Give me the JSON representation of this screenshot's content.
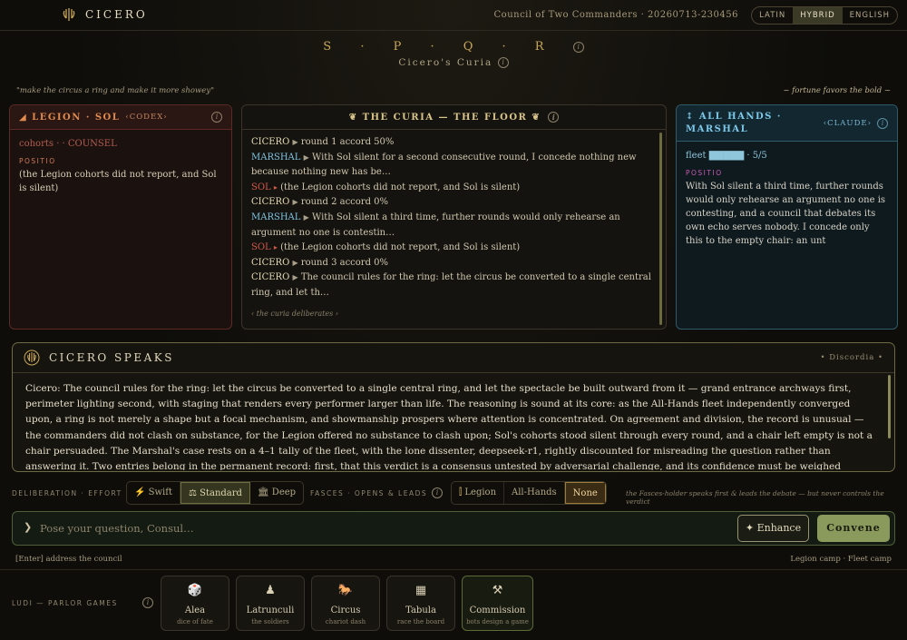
{
  "header": {
    "brand": "CICERO",
    "session": "Council of Two Commanders · 20260713-230456",
    "languages": [
      "LATIN",
      "HYBRID",
      "ENGLISH"
    ],
    "active_language": "HYBRID"
  },
  "title_block": {
    "title": "S · P · Q · R",
    "subtitle": "Cicero's Curia"
  },
  "mottos": {
    "left": "\"make the circus a ring and make it more showey\"",
    "right": "~ fortune favors the bold ~"
  },
  "legion_panel": {
    "title": "◢ LEGION · SOL",
    "tag": "‹CODEX›",
    "cohorts": "cohorts · · COUNSEL",
    "positio_label": "POSITIO",
    "text": "(the Legion cohorts did not report, and Sol is silent)"
  },
  "curia_panel": {
    "title": "❦ THE CURIA — THE FLOOR ❦",
    "lines": [
      {
        "speaker": "CICERO",
        "text": "round 1 accord 50%"
      },
      {
        "speaker": "MARSHAL",
        "text": "With Sol silent for a second consecutive round, I concede nothing new because nothing new has be…"
      },
      {
        "speaker": "SOL",
        "text": "(the Legion cohorts did not report, and Sol is silent)"
      },
      {
        "speaker": "CICERO",
        "text": "round 2 accord 0%"
      },
      {
        "speaker": "MARSHAL",
        "text": "With Sol silent a third time, further rounds would only rehearse an argument no one is contestin…"
      },
      {
        "speaker": "SOL",
        "text": "(the Legion cohorts did not report, and Sol is silent)"
      },
      {
        "speaker": "CICERO",
        "text": "round 3 accord 0%"
      },
      {
        "speaker": "CICERO",
        "text": "The council rules for the ring: let the circus be converted to a single central ring, and let th…"
      }
    ],
    "footer": "‹ the curia deliberates ›"
  },
  "allhands_panel": {
    "title": "↕ ALL HANDS · MARSHAL",
    "tag": "‹CLAUDE›",
    "fleet": "fleet ▇▇▇▇▇ · 5/5",
    "positio_label": "POSITIO",
    "text": "With Sol silent a third time, further rounds would only rehearse an argument no one is contesting, and a council that debates its own echo serves nobody. I concede only this to the empty chair: an unt"
  },
  "speaks_panel": {
    "title": "CICERO SPEAKS",
    "tag": "• Discordia •",
    "body": "Cicero: The council rules for the ring: let the circus be converted to a single central ring, and let the spectacle be built outward from it — grand entrance archways first, perimeter lighting second, with staging that renders every performer larger than life. The reasoning is sound at its core: as the All-Hands fleet independently converged upon, a ring is not merely a shape but a focal mechanism, and showmanship prospers where attention is concentrated. On agreement and division, the record is unusual — the commanders did not clash on substance, for the Legion offered no substance to clash upon; Sol's cohorts stood silent through every round, and a chair left empty is not a chair persuaded. The Marshal's case rests on a 4–1 tally of the fleet, with the lone dissenter, deepseek-r1, rightly discounted for misreading the question rather than answering it. Two entries belong in the permanent record: first, that this verdict is a consensus untested by adversarial challenge, and its confidence must be weighed accordingly; second, the Marshal's own proviso, which the council adopts — any late, substantive report"
  },
  "controls": {
    "deliberation_label": "DELIBERATION · EFFORT",
    "effort_options": [
      "⚡ Swift",
      "⚖ Standard",
      "🏛 Deep"
    ],
    "effort_selected": "Standard",
    "fasces_label": "FASCES · OPENS & LEADS",
    "fasces_options": [
      "Legion",
      "All-Hands",
      "None"
    ],
    "fasces_selected": "None",
    "note": "the Fasces-holder speaks first & leads the debate — but never controls the verdict"
  },
  "input": {
    "placeholder": "Pose your question, Consul…",
    "enhance_label": "✦ Enhance",
    "convene_label": "Convene",
    "hint_left": "[Enter] address the council",
    "hint_right": "Legion camp · Fleet camp"
  },
  "ludi": {
    "label": "LUDI — PARLOR GAMES",
    "games": [
      {
        "icon": "🎲",
        "name": "Alea",
        "sub": "dice of fate"
      },
      {
        "icon": "♟",
        "name": "Latrunculi",
        "sub": "the soldiers"
      },
      {
        "icon": "🐎",
        "name": "Circus",
        "sub": "chariot dash"
      },
      {
        "icon": "▦",
        "name": "Tabula",
        "sub": "race the board"
      },
      {
        "icon": "⚒",
        "name": "Commission",
        "sub": "bots design a game"
      }
    ]
  },
  "colors": {
    "accent_gold": "#c9a659",
    "legion_red": "#e08a4e",
    "marshal_blue": "#7cc8e8",
    "convene_green": "#8a9a5c"
  }
}
